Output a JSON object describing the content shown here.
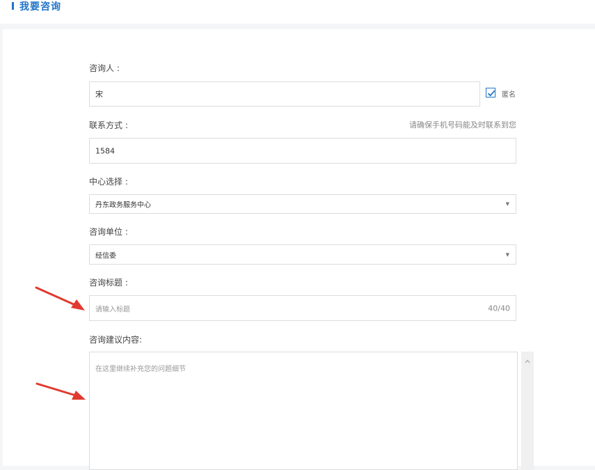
{
  "header": {
    "title": "我要咨询"
  },
  "form": {
    "consultant": {
      "label": "咨询人 :",
      "value": "宋"
    },
    "anonymous": {
      "label": "匿名",
      "checked": true
    },
    "contact": {
      "label": "联系方式 :",
      "value": "1584",
      "hint": "请确保手机号码能及时联系到您"
    },
    "center": {
      "label": "中心选择 :",
      "selected": "丹东政务服务中心"
    },
    "unit": {
      "label": "咨询单位 :",
      "selected": "经信委"
    },
    "title": {
      "label": "咨询标题 :",
      "placeholder": "请输入标题",
      "counter": "40/40"
    },
    "content": {
      "label": "咨询建议内容:",
      "placeholder": "在这里继续补充您的问题细节"
    }
  },
  "colors": {
    "accent": "#1f74c6",
    "annotation_arrow": "#e03a2f"
  }
}
